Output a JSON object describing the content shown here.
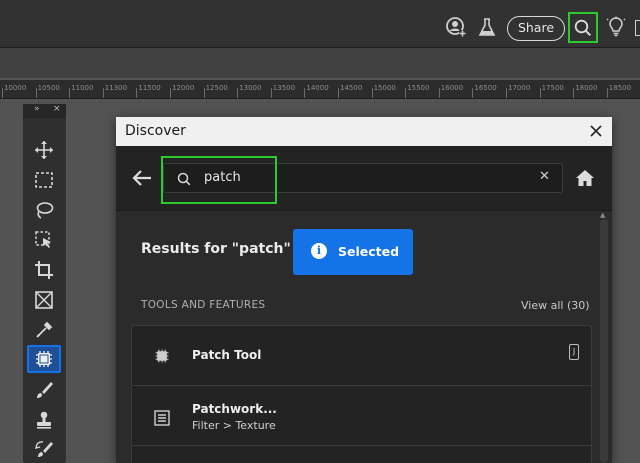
{
  "topbar": {
    "share_label": "Share",
    "icons": [
      "user-add-icon",
      "beaker-icon",
      "search-icon",
      "lightbulb-icon"
    ]
  },
  "ruler": {
    "ticks": [
      "10000",
      "10500",
      "11000",
      "11300",
      "11500",
      "12000",
      "12500",
      "13000",
      "13500",
      "14000",
      "14500",
      "15000",
      "15500",
      "16000",
      "16500",
      "17000",
      "17500",
      "18000",
      "18500"
    ]
  },
  "toolbar": {
    "collapse_label": "»",
    "close_label": "×",
    "tools": [
      "move-tool-icon",
      "marquee-tool-icon",
      "lasso-tool-icon",
      "object-select-tool-icon",
      "crop-tool-icon",
      "frame-tool-icon",
      "eyedropper-tool-icon",
      "patch-tool-icon",
      "brush-tool-icon",
      "stamp-tool-icon",
      "history-brush-tool-icon"
    ],
    "selected_tool": "patch-tool-icon"
  },
  "discover": {
    "title": "Discover",
    "search_value": "patch",
    "results_title": "Results for \"patch\"",
    "selected_button": "Selected",
    "section_header": "TOOLS AND FEATURES",
    "view_all": "View all (30)",
    "items": [
      {
        "name": "Patch Tool",
        "sub": "",
        "shortcut": "J"
      },
      {
        "name": "Patchwork...",
        "sub": "Filter > Texture",
        "shortcut": ""
      }
    ]
  },
  "colors": {
    "highlight": "#2ec92e",
    "accent": "#1473e6"
  }
}
